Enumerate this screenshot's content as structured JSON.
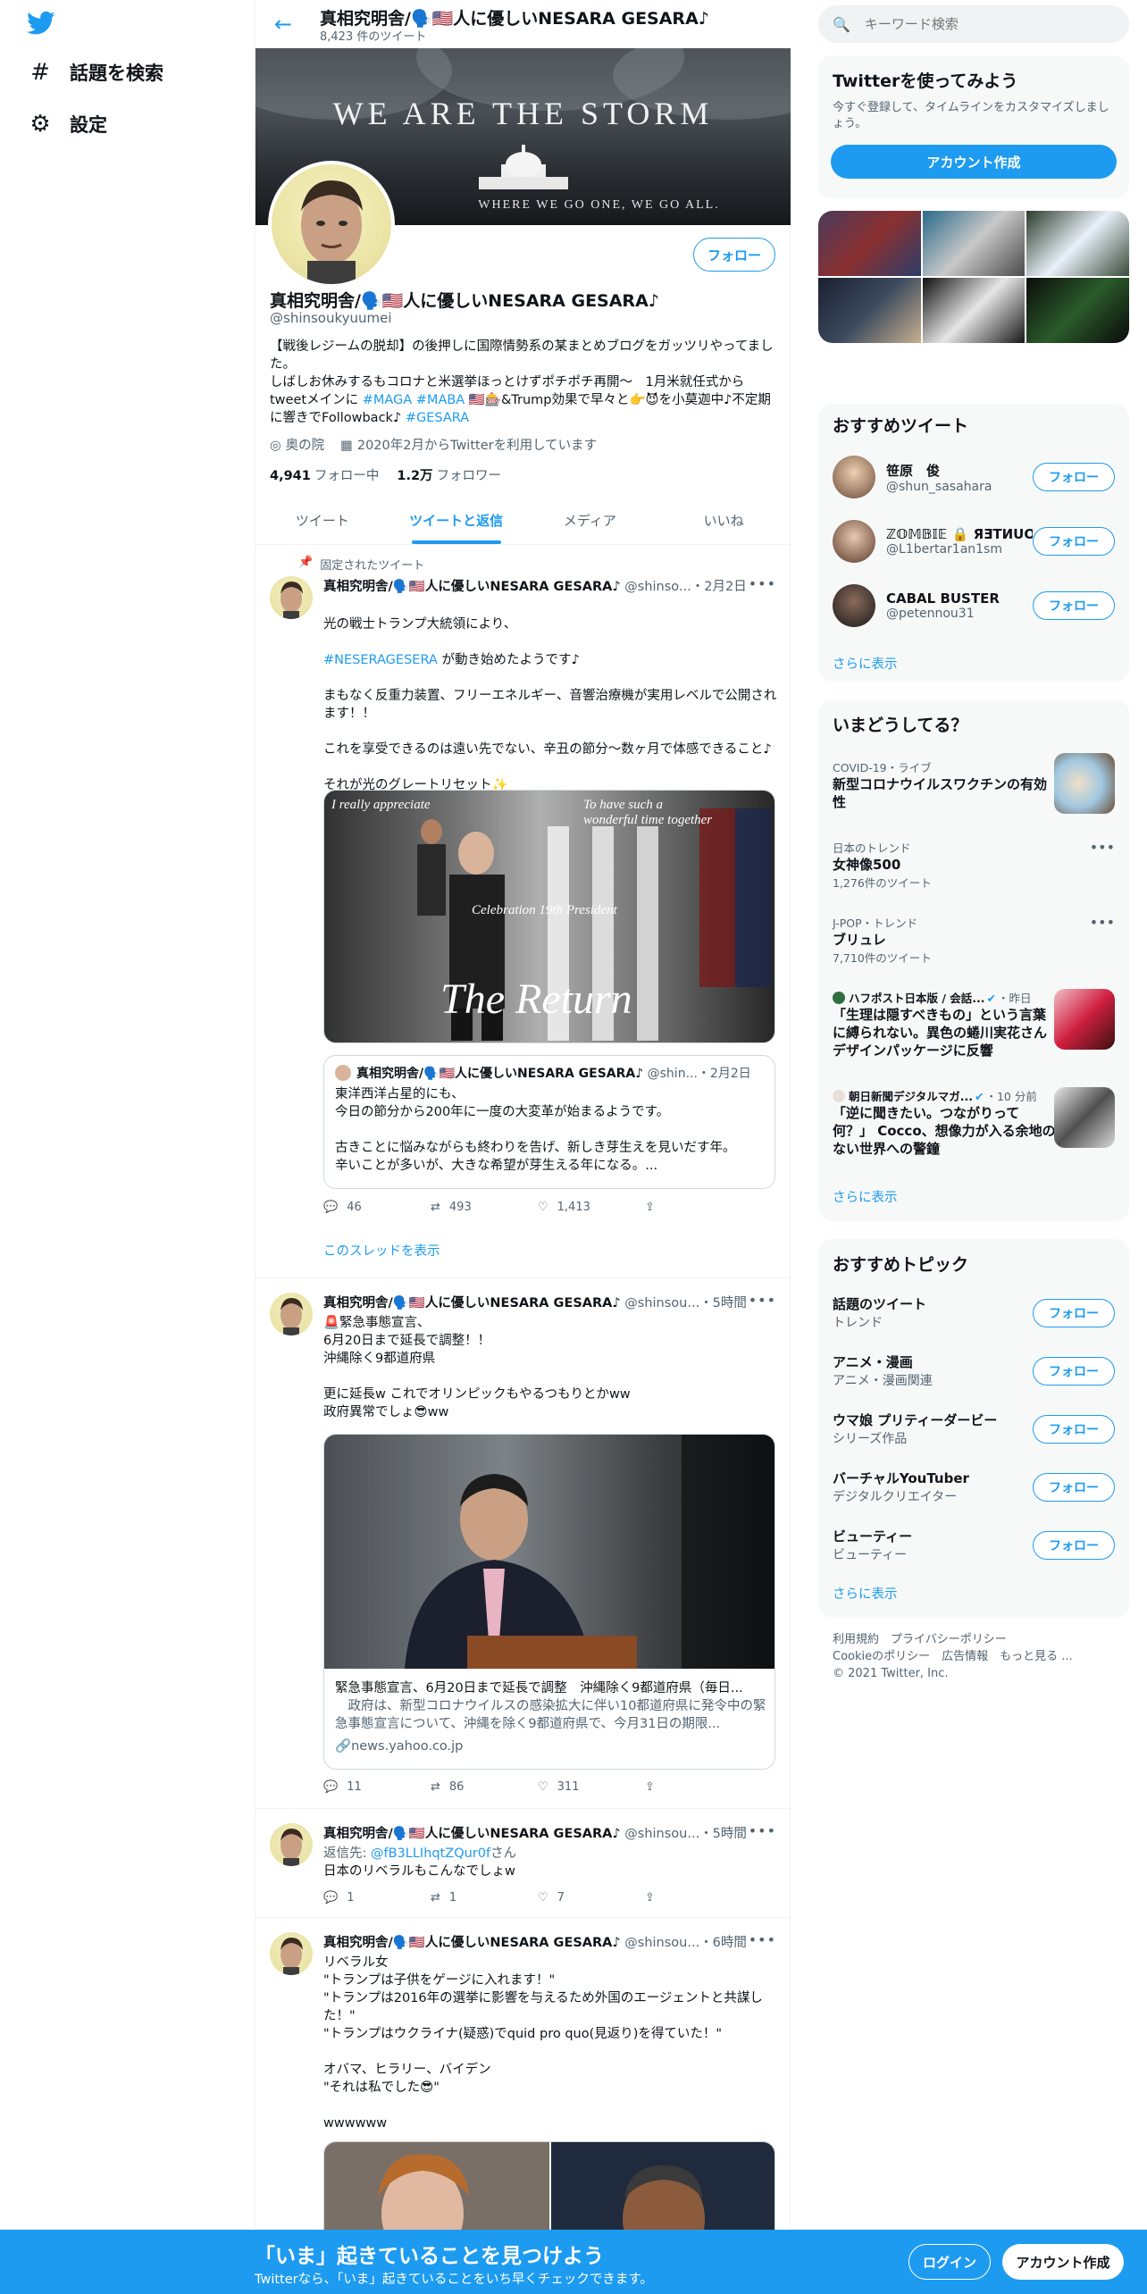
{
  "nav": {
    "explore_label": "話題を検索",
    "settings_label": "設定"
  },
  "profile": {
    "header_name": "真相究明舎/🗣️🇺🇸人に優しいNESARA GESARA♪",
    "tweet_count": "8,423 件のツイート",
    "banner_title": "WE ARE THE STORM",
    "banner_sub": "WHERE WE GO ONE, WE GO ALL.",
    "follow_label": "フォロー",
    "name": "真相究明舎/🗣️🇺🇸人に優しいNESARA GESARA♪",
    "handle": "@shinsoukyuumei",
    "bio_1": "【戦後レジームの脱却】の後押しに国際情勢系の某まとめブログをガッツリやってました。",
    "bio_2": "しばしお休みするもコロナと米選挙ほっとけずポチポチ再開〜　1月米就任式から",
    "bio_3a": "tweetメインに ",
    "bio_tag1": "#MAGA",
    "bio_tag2": "#MABA",
    "bio_3b": " 🇺🇸🎰&Trump効果で早々と👉😈を小莫迦中♪不定期",
    "bio_4a": "に響きでFollowback♪ ",
    "bio_tag3": "#GESARA",
    "location": "奥の院",
    "joined": "2020年2月からTwitterを利用しています",
    "following_count": "4,941",
    "following_label": "フォロー中",
    "followers_count": "1.2万",
    "followers_label": "フォロワー"
  },
  "tabs": [
    {
      "label": "ツイート"
    },
    {
      "label": "ツイートと返信"
    },
    {
      "label": "メディア"
    },
    {
      "label": "いいね"
    }
  ],
  "tweets": [
    {
      "pinned_label": "固定されたツイート",
      "name": "真相究明舎/🗣️🇺🇸人に優しいNESARA GESARA♪",
      "handle": "@shinso...",
      "time": "・2月2日",
      "text_1": "光の戦士トランプ大統領により、",
      "tag": "#NESERAGESERA",
      "text_2": " が動き始めたようです♪",
      "text_3": "まもなく反重力装置、フリーエネルギー、音響治療機が実用レベルで公開されます！！\n\nこれを享受できるのは遠い先でない、辛丑の節分〜数ヶ月で体感できること♪\n\nそれが光のグレートリセット✨",
      "img_text_1": "I really appreciate",
      "img_text_2": "To have such a wonderful time together",
      "img_text_3": "Celebration 19th President",
      "img_text_4": "The Return",
      "quote_name": "真相究明舎/🗣️🇺🇸人に優しいNESARA GESARA♪",
      "quote_handle": "@shin...",
      "quote_time": "・2月2日",
      "quote_text": "東洋西洋占星的にも、\n今日の節分から200年に一度の大変革が始まるようです。\n\n古きことに悩みながらも終わりを告げ、新しき芽生えを見いだす年。\n辛いことが多いが、大きな希望が芽生える年になる。...",
      "replies": "46",
      "retweets": "493",
      "likes": "1,413",
      "show_thread": "このスレッドを表示"
    },
    {
      "name": "真相究明舎/🗣️🇺🇸人に優しいNESARA GESARA♪",
      "handle": "@shinsou...",
      "time": "・5時間",
      "text": "🚨緊急事態宣言、\n6月20日まで延長で調整！！\n沖縄除く9都道府県\n\n更に延長w これでオリンピックもやるつもりとかww\n政府異常でしょ😎ww",
      "card_title": "緊急事態宣言、6月20日まで延長で調整　沖縄除く9都道府県（毎日...",
      "card_desc": "　政府は、新型コロナウイルスの感染拡大に伴い10都道府県に発令中の緊急事態宣言について、沖縄を除く9都道府県で、今月31日の期限...",
      "card_domain": "news.yahoo.co.jp",
      "replies": "11",
      "retweets": "86",
      "likes": "311"
    },
    {
      "name": "真相究明舎/🗣️🇺🇸人に優しいNESARA GESARA♪",
      "handle": "@shinsou...",
      "time": "・5時間",
      "reply_prefix": "返信先: ",
      "reply_to": "@fB3LLIhqtZQur0f",
      "reply_suffix": "さん",
      "text": "日本のリベラルもこんなでしょw",
      "replies": "1",
      "retweets": "1",
      "likes": "7"
    },
    {
      "name": "真相究明舎/🗣️🇺🇸人に優しいNESARA GESARA♪",
      "handle": "@shinsou...",
      "time": "・6時間",
      "text": "リベラル女\n\"トランプは子供をゲージに入れます！\"\n\"トランプは2016年の選挙に影響を与えるため外国のエージェントと共謀した！\"\n\"トランプはウクライナ(疑惑)でquid pro quo(見返り)を得ていた！\"\n\nオバマ、ヒラリー、バイデン\n\"それは私でした😎\"\n\nwwwwww"
    }
  ],
  "right": {
    "search_placeholder": "キーワード検索",
    "signup_title": "Twitterを使ってみよう",
    "signup_desc": "今すぐ登録して、タイムラインをカスタマイズしましょう。",
    "signup_button": "アカウント作成",
    "who_title": "おすすめツイート",
    "who": [
      {
        "name": "笹原　俊",
        "handle": "@shun_sasahara",
        "follow": "フォロー"
      },
      {
        "name": "ℤ𝕆𝕄𝔹𝕀𝔼 🔒 ЯƎTИUOƆ",
        "handle": "@L1bertar1an1sm",
        "follow": "フォロー"
      },
      {
        "name": "CABAL BUSTER",
        "handle": "@petennou31",
        "follow": "フォロー"
      }
    ],
    "who_more": "さらに表示",
    "trends_title": "いまどうしてる？",
    "trends": [
      {
        "meta": "COVID-19・ライブ",
        "title": "新型コロナウイルスワクチンの有効性",
        "sub": ""
      },
      {
        "meta": "日本のトレンド",
        "title": "女神像500",
        "sub": "1,276件のツイート"
      },
      {
        "meta": "J-POP・トレンド",
        "title": "ブリュレ",
        "sub": "7,710件のツイート"
      },
      {
        "meta": "ハフポスト日本版 / 会話...",
        "meta_time": "・昨日",
        "title": "「生理は隠すべきもの」という言葉に縛られない。異色の蜷川実花さんデザインパッケージに反響",
        "sub": ""
      },
      {
        "meta": "朝日新聞デジタルマガ...",
        "meta_time": "・10 分前",
        "title": "「逆に聞きたい。つながりって何？」 Cocco、想像力が入る余地のない世界への警鐘",
        "sub": ""
      }
    ],
    "trends_more": "さらに表示",
    "topics_title": "おすすめトピック",
    "topics": [
      {
        "title": "話題のツイート",
        "sub": "トレンド",
        "follow": "フォロー"
      },
      {
        "title": "アニメ・漫画",
        "sub": "アニメ・漫画関連",
        "follow": "フォロー"
      },
      {
        "title": "ウマ娘 プリティーダービー",
        "sub": "シリーズ作品",
        "follow": "フォロー"
      },
      {
        "title": "バーチャルYouTuber",
        "sub": "デジタルクリエイター",
        "follow": "フォロー"
      },
      {
        "title": "ビューティー",
        "sub": "ビューティー",
        "follow": "フォロー"
      }
    ],
    "topics_more": "さらに表示",
    "footer_1": "利用規約　プライバシーポリシー",
    "footer_2": "Cookieのポリシー　広告情報　もっと見る ...",
    "footer_3": "© 2021 Twitter, Inc."
  },
  "bottom": {
    "title": "「いま」起きていることを見つけよう",
    "sub": "Twitterなら、「いま」起きていることをいち早くチェックできます。",
    "login": "ログイン",
    "signup": "アカウント作成"
  },
  "colors": {
    "accent": "#1d9bf0",
    "text": "#0f1419",
    "secondary": "#536471",
    "panel": "#f7f9f9"
  }
}
